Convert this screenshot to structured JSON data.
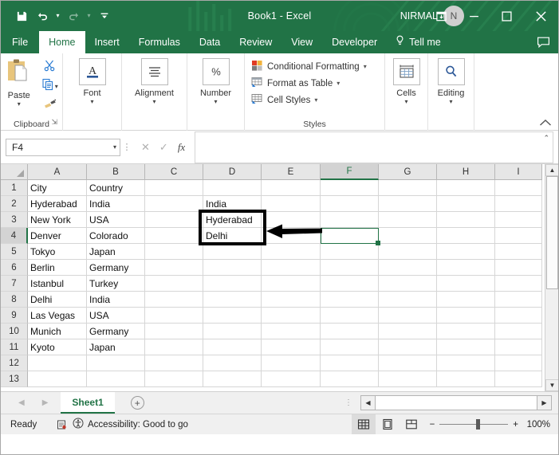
{
  "titlebar": {
    "document_title": "Book1  -  Excel",
    "account_name": "NIRMAL",
    "avatar_initial": "N",
    "qat": [
      {
        "name": "save",
        "icon": "save-icon"
      },
      {
        "name": "undo",
        "icon": "undo-icon"
      },
      {
        "name": "redo",
        "icon": "redo-icon"
      },
      {
        "name": "customize-quick-access-toolbar",
        "icon": "chevron-down-icon"
      }
    ],
    "window": {
      "ribbon_display_options": "ribbon-display-options-icon",
      "minimize": "minimize-icon",
      "maximize": "maximize-icon",
      "close": "close-icon"
    }
  },
  "ribbon_tabs": [
    {
      "label": "File",
      "active": false
    },
    {
      "label": "Home",
      "active": true
    },
    {
      "label": "Insert",
      "active": false
    },
    {
      "label": "Formulas",
      "active": false
    },
    {
      "label": "Data",
      "active": false
    },
    {
      "label": "Review",
      "active": false
    },
    {
      "label": "View",
      "active": false
    },
    {
      "label": "Developer",
      "active": false
    }
  ],
  "tell_me": {
    "label": "Tell me",
    "icon": "lightbulb-icon"
  },
  "comments": {
    "icon": "comment-icon"
  },
  "ribbon": {
    "clipboard": {
      "group_label": "Clipboard",
      "paste_label": "Paste",
      "cut_icon": "scissors-icon",
      "copy_icon": "copy-icon",
      "format_painter_icon": "format-painter-icon",
      "dialog_launcher": "dialog-launcher-icon"
    },
    "font": {
      "label": "Font",
      "icon": "font-A-icon"
    },
    "alignment": {
      "label": "Alignment",
      "icon": "align-lines-icon"
    },
    "number": {
      "label": "Number",
      "icon": "percent-icon"
    },
    "styles": {
      "group_label": "Styles",
      "items": [
        {
          "label": "Conditional Formatting",
          "icon": "conditional-formatting-icon"
        },
        {
          "label": "Format as Table",
          "icon": "format-as-table-icon"
        },
        {
          "label": "Cell Styles",
          "icon": "cell-styles-icon"
        }
      ]
    },
    "cells": {
      "label": "Cells",
      "icon": "cells-icon"
    },
    "editing": {
      "label": "Editing",
      "icon": "magnifier-icon"
    },
    "collapse": "collapse-ribbon-icon"
  },
  "formula_bar": {
    "name_box_value": "F4",
    "name_box_placeholder": "Name Box",
    "cancel_icon": "cancel-x-icon",
    "enter_icon": "enter-check-icon",
    "function_icon": "fx-icon",
    "formula_value": "",
    "formula_placeholder": "",
    "expand_icon": "expand-formula-bar-icon"
  },
  "grid": {
    "columns": [
      "A",
      "B",
      "C",
      "D",
      "E",
      "F",
      "G",
      "H",
      "I"
    ],
    "selected_column": "F",
    "rows": [
      1,
      2,
      3,
      4,
      5,
      6,
      7,
      8,
      9,
      10,
      11,
      12,
      13
    ],
    "selected_row": 4,
    "cells": [
      {
        "col": "A",
        "row": 1,
        "value": "City"
      },
      {
        "col": "B",
        "row": 1,
        "value": "Country"
      },
      {
        "col": "A",
        "row": 2,
        "value": "Hyderabad"
      },
      {
        "col": "B",
        "row": 2,
        "value": "India"
      },
      {
        "col": "D",
        "row": 2,
        "value": "India"
      },
      {
        "col": "A",
        "row": 3,
        "value": "New York"
      },
      {
        "col": "B",
        "row": 3,
        "value": "USA"
      },
      {
        "col": "D",
        "row": 3,
        "value": "Hyderabad"
      },
      {
        "col": "A",
        "row": 4,
        "value": "Denver"
      },
      {
        "col": "B",
        "row": 4,
        "value": "Colorado"
      },
      {
        "col": "D",
        "row": 4,
        "value": "Delhi"
      },
      {
        "col": "A",
        "row": 5,
        "value": "Tokyo"
      },
      {
        "col": "B",
        "row": 5,
        "value": "Japan"
      },
      {
        "col": "A",
        "row": 6,
        "value": "Berlin"
      },
      {
        "col": "B",
        "row": 6,
        "value": "Germany"
      },
      {
        "col": "A",
        "row": 7,
        "value": "Istanbul"
      },
      {
        "col": "B",
        "row": 7,
        "value": "Turkey"
      },
      {
        "col": "A",
        "row": 8,
        "value": "Delhi"
      },
      {
        "col": "B",
        "row": 8,
        "value": "India"
      },
      {
        "col": "A",
        "row": 9,
        "value": "Las Vegas"
      },
      {
        "col": "B",
        "row": 9,
        "value": "USA"
      },
      {
        "col": "A",
        "row": 10,
        "value": "Munich"
      },
      {
        "col": "B",
        "row": 10,
        "value": "Germany"
      },
      {
        "col": "A",
        "row": 11,
        "value": "Kyoto"
      },
      {
        "col": "B",
        "row": 11,
        "value": "Japan"
      }
    ],
    "active_cell": "F4",
    "annotation_box_range": "D3:D4",
    "annotation_arrow": "left-pointing-arrow",
    "paste_options_icon": "paste-options-icon",
    "selection_color": "#217346",
    "annotation_color": "#000000",
    "scroll_up_icon": "scroll-up-icon",
    "scroll_down_icon": "scroll-down-icon"
  },
  "sheet_bar": {
    "prev_icon": "previous-sheet-icon",
    "next_icon": "next-sheet-icon",
    "tabs": [
      {
        "label": "Sheet1",
        "active": true
      }
    ],
    "add_sheet_icon": "add-sheet-icon",
    "scroll_left_icon": "scroll-left-icon",
    "scroll_right_icon": "scroll-right-icon"
  },
  "status_bar": {
    "mode": "Ready",
    "macro_icon": "record-macro-icon",
    "accessibility_icon": "accessibility-icon",
    "accessibility_text": "Accessibility: Good to go",
    "views": [
      {
        "name": "normal-view",
        "icon": "normal-view-icon",
        "active": true
      },
      {
        "name": "page-layout-view",
        "icon": "page-layout-icon",
        "active": false
      },
      {
        "name": "page-break-preview",
        "icon": "page-break-icon",
        "active": false
      }
    ],
    "zoom_out_icon": "minus-icon",
    "zoom_in_icon": "plus-icon",
    "zoom_level": "100%"
  }
}
